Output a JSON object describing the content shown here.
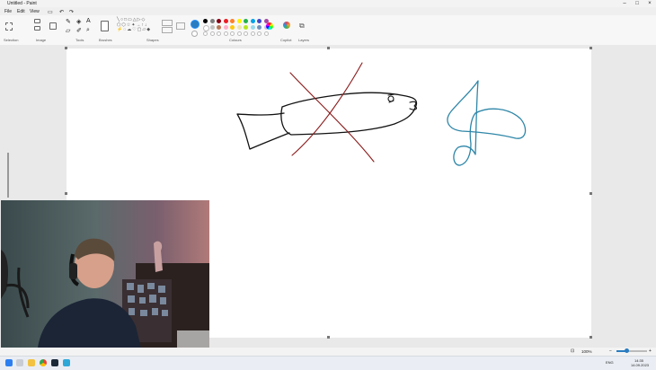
{
  "window": {
    "title": "Untitled - Paint"
  },
  "menu": {
    "file": "File",
    "edit": "Edit",
    "view": "View"
  },
  "ribbon": {
    "groups": [
      "Selection",
      "Image",
      "Tools",
      "Brushes",
      "Shapes",
      "Colours",
      "Copilot",
      "Layers"
    ]
  },
  "colors": {
    "accent": "#1e90ff",
    "fish_stroke": "#111111",
    "cross_stroke": "#8b1a1a",
    "note_stroke": "#2e86a8",
    "palette": [
      "#000000",
      "#7f7f7f",
      "#880015",
      "#ed1c24",
      "#ff7f27",
      "#fff200",
      "#22b14c",
      "#00a2e8",
      "#3f48cc",
      "#a349a4",
      "#ffffff",
      "#c3c3c3",
      "#b97a57",
      "#ffaec9",
      "#ffc90e",
      "#efe4b0",
      "#b5e61d",
      "#99d9ea",
      "#7092be",
      "#c8bfe7"
    ]
  },
  "status": {
    "zoom": "100%"
  },
  "taskbar": {
    "time": "14:35",
    "date": "14.09.2023",
    "lang": "ENG"
  },
  "icons": [
    "start-icon",
    "search-icon",
    "file-explorer-icon",
    "chrome-icon",
    "steam-icon",
    "paint-icon"
  ]
}
